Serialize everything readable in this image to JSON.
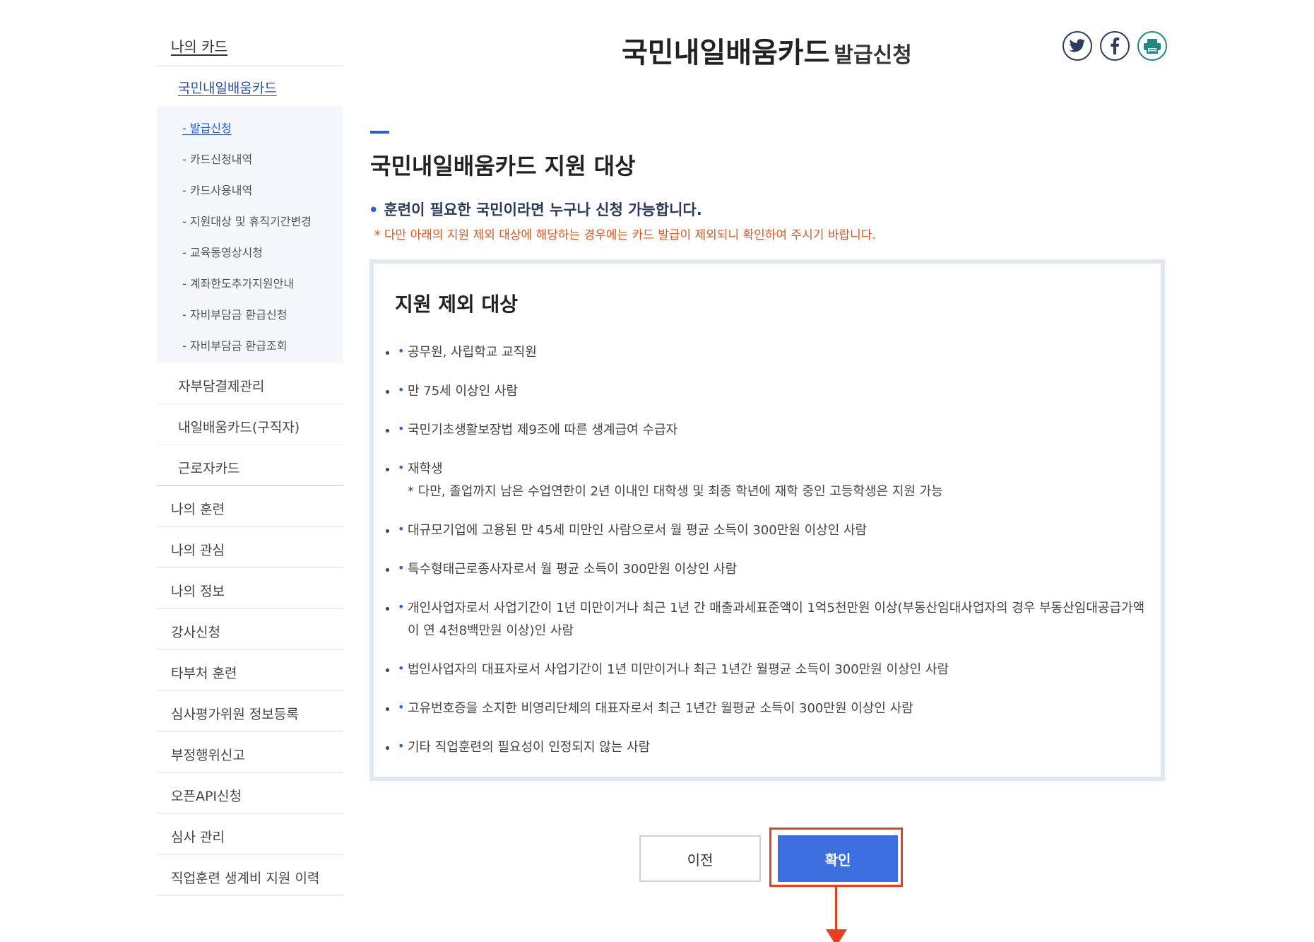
{
  "sidebar": {
    "title": "나의 카드",
    "sub_title": "국민내일배움카드",
    "sub_items": [
      {
        "label": "- 발급신청"
      },
      {
        "label": "- 카드신청내역"
      },
      {
        "label": "- 카드사용내역"
      },
      {
        "label": "- 지원대상 및 휴직기간변경"
      },
      {
        "label": "- 교육동영상시청"
      },
      {
        "label": "- 계좌한도추가지원안내"
      },
      {
        "label": "- 자비부담금 환급신청"
      },
      {
        "label": "- 자비부담금 환급조회"
      }
    ],
    "card_groups": [
      {
        "label": "자부담결제관리"
      },
      {
        "label": "내일배움카드(구직자)"
      },
      {
        "label": "근로자카드"
      }
    ],
    "main_items": [
      {
        "label": "나의 훈련"
      },
      {
        "label": "나의 관심"
      },
      {
        "label": "나의 정보"
      },
      {
        "label": "강사신청"
      },
      {
        "label": "타부처 훈련"
      },
      {
        "label": "심사평가위원 정보등록"
      },
      {
        "label": "부정행위신고"
      },
      {
        "label": "오픈API신청"
      },
      {
        "label": "심사 관리"
      },
      {
        "label": "직업훈련 생계비 지원 이력"
      }
    ]
  },
  "header": {
    "title": "국민내일배움카드",
    "subtitle": "발급신청"
  },
  "share": {
    "twitter_icon": "twitter-icon",
    "facebook_icon": "facebook-icon",
    "print_icon": "print-icon"
  },
  "content": {
    "section_title": "국민내일배움카드 지원 대상",
    "note_bullet": "•",
    "note_main": "훈련이 필요한 국민이라면 누구나 신청 가능합니다.",
    "note_warning": "* 다만 아래의 지원 제외 대상에 해당하는 경우에는 카드 발급이 제외되니 확인하여 주시기 바랍니다.",
    "exclusion_title": "지원 제외 대상",
    "exclusions": [
      {
        "text": "공무원, 사립학교 교직원",
        "sub": ""
      },
      {
        "text": "만 75세 이상인 사람",
        "sub": ""
      },
      {
        "text": "국민기초생활보장법 제9조에 따른 생계급여 수급자",
        "sub": ""
      },
      {
        "text": "재학생",
        "sub": "* 다만, 졸업까지 남은 수업연한이 2년 이내인 대학생 및 최종 학년에 재학 중인 고등학생은 지원 가능"
      },
      {
        "text": "대규모기업에 고용된 만 45세 미만인 사람으로서 월 평균 소득이 300만원 이상인 사람",
        "sub": ""
      },
      {
        "text": "특수형태근로종사자로서 월 평균 소득이 300만원 이상인 사람",
        "sub": ""
      },
      {
        "text": "개인사업자로서 사업기간이 1년 미만이거나 최근 1년 간 매출과세표준액이 1억5천만원 이상(부동산임대사업자의 경우 부동산임대공급가액이 연 4천8백만원 이상)인 사람",
        "sub": ""
      },
      {
        "text": "법인사업자의 대표자로서 사업기간이 1년 미만이거나 최근 1년간 월평균 소득이 300만원 이상인 사람",
        "sub": ""
      },
      {
        "text": "고유번호증을 소지한 비영리단체의 대표자로서 최근 1년간 월평균 소득이 300만원 이상인 사람",
        "sub": ""
      },
      {
        "text": "기타 직업훈련의 필요성이 인정되지 않는 사람",
        "sub": ""
      }
    ]
  },
  "buttons": {
    "prev_label": "이전",
    "confirm_label": "확인"
  },
  "colors": {
    "accent": "#2b5fd9",
    "confirm_button": "#3d6fe0",
    "highlight": "#e8401c",
    "warning_text": "#e0561e"
  }
}
